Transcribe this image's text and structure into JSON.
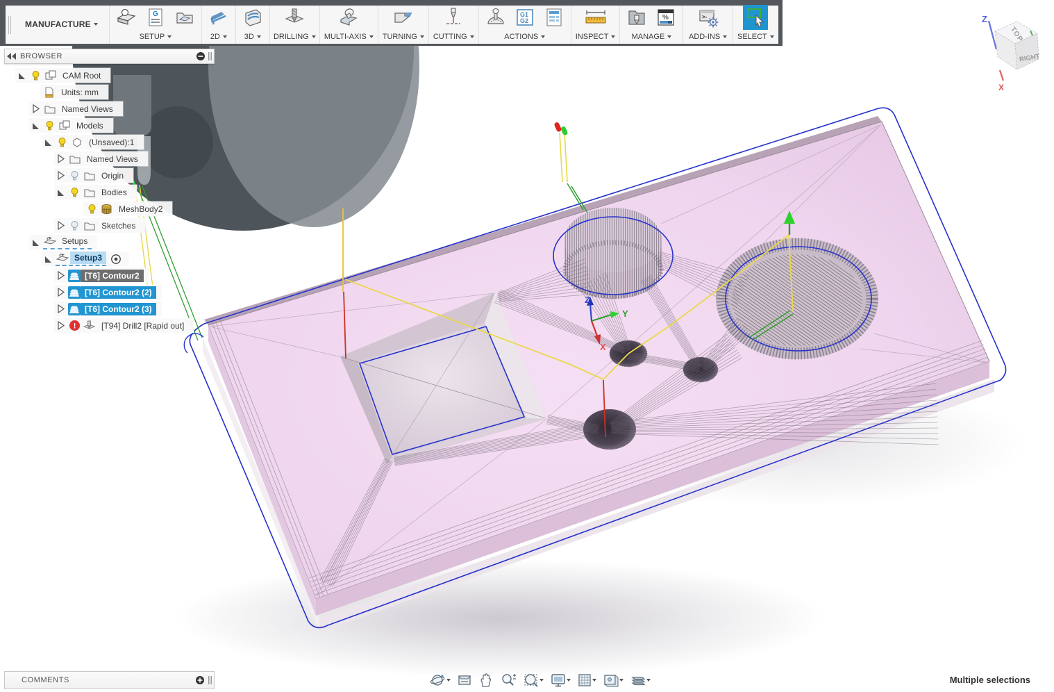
{
  "app": {
    "workspace_label": "MANUFACTURE"
  },
  "toolbar": {
    "groups": [
      {
        "label": "SETUP"
      },
      {
        "label": "2D"
      },
      {
        "label": "3D"
      },
      {
        "label": "DRILLING"
      },
      {
        "label": "MULTI-AXIS"
      },
      {
        "label": "TURNING"
      },
      {
        "label": "CUTTING"
      },
      {
        "label": "ACTIONS"
      },
      {
        "label": "INSPECT"
      },
      {
        "label": "MANAGE"
      },
      {
        "label": "ADD-INS"
      },
      {
        "label": "SELECT"
      }
    ],
    "icon_glyphs": {
      "ncprogram_g": "G",
      "post_g1": "G1",
      "post_g2": "G2",
      "percent": "%",
      "prompt": ">-"
    }
  },
  "browser": {
    "header": "BROWSER",
    "error_glyph": "!",
    "rows": [
      {
        "label": "CAM Root"
      },
      {
        "label": "Units: mm"
      },
      {
        "label": "Named Views"
      },
      {
        "label": "Models"
      },
      {
        "label": "(Unsaved):1"
      },
      {
        "label": "Named Views"
      },
      {
        "label": "Origin"
      },
      {
        "label": "Bodies"
      },
      {
        "label": "MeshBody2"
      },
      {
        "label": "Sketches"
      },
      {
        "label": "Setups"
      },
      {
        "label": "Setup3"
      },
      {
        "label": "[T6] Contour2"
      },
      {
        "label": "[T6] Contour2 (2)"
      },
      {
        "label": "[T6] Contour2 (3)"
      },
      {
        "label": "[T94] Drill2 [Rapid out]"
      }
    ]
  },
  "viewport": {
    "triad": {
      "x": "X",
      "y": "Y",
      "z": "Z"
    },
    "viewcube": {
      "top": "TOP",
      "right": "RIGHT",
      "z": "Z",
      "x": "X"
    },
    "status": "Multiple selections"
  },
  "comments": {
    "header": "COMMENTS"
  },
  "colors": {
    "selection_blue": "#2195d1",
    "selected_gray": "#6e6e6e",
    "setup_highlight": "#b9dcf3",
    "error_red": "#e03131",
    "rapid_yellow": "#ead84a",
    "lead_green": "#2f9e2f",
    "plunge_red": "#d03020",
    "stock_outline_blue": "#2633cc",
    "part_pink": "#f0d8ef"
  }
}
